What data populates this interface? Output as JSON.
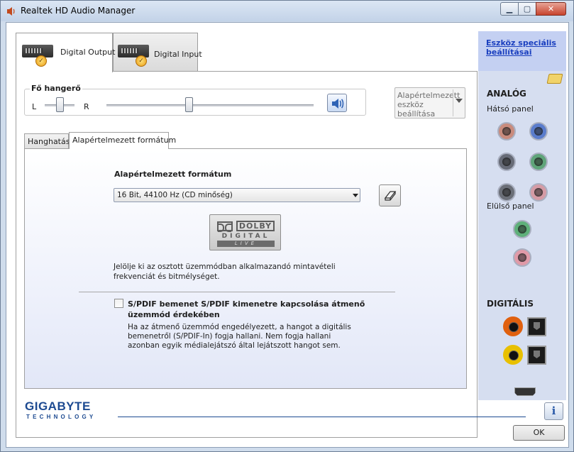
{
  "window": {
    "title": "Realtek HD Audio Manager",
    "controls": {
      "minimize": "▁",
      "maximize": "▢",
      "close": "✕"
    }
  },
  "device_tabs": [
    {
      "label": "Digital Output",
      "active": true,
      "icon": "digital-output-device-icon"
    },
    {
      "label": "Digital Input",
      "active": false,
      "icon": "digital-input-device-icon"
    }
  ],
  "volume": {
    "legend": "Fő hangerő",
    "left_label": "L",
    "right_label": "R",
    "balance_position": 0.5,
    "level": 0.4
  },
  "default_device_button": "Alapértelmezett eszköz beállítása",
  "sub_tabs": [
    {
      "label": "Hanghatás",
      "active": false
    },
    {
      "label": "Alapértelmezett formátum",
      "active": true
    }
  ],
  "format": {
    "title": "Alapértelmezett formátum",
    "selected": "16 Bit, 44100 Hz (CD minőség)",
    "dolby": {
      "word": "DOLBY",
      "digital": "DIGITAL",
      "live": "LIVE"
    },
    "description": "Jelölje ki az osztott üzemmódban alkalmazandó mintavételi frekvenciát és bitmélységet.",
    "spdif_label": "S/PDIF bemenet S/PDIF kimenetre kapcsolása átmenő üzemmód érdekében",
    "spdif_checked": false,
    "spdif_description": "Ha az átmenő üzemmód engedélyezett, a hangot a digitális bemenetről (S/PDIF-In) fogja hallani. Nem fogja hallani azonban egyik médialejátszó által lejátszott hangot sem."
  },
  "sidebar": {
    "link": "Eszköz speciális beállításai",
    "analog_title": "ANALÓG",
    "rear_panel": "Hátsó panel",
    "front_panel": "Elülső panel",
    "digital_title": "DIGITÁLIS",
    "rear_jacks": [
      "#c98b7d",
      "#5a7ccc",
      "#676b77",
      "#5fa479",
      "#6b6f78",
      "#d59ba5"
    ],
    "front_jacks": [
      "#5fb07a",
      "#e09aa8"
    ]
  },
  "footer": {
    "brand": "GIGABYTE",
    "brand_sub": "TECHNOLOGY",
    "info_icon": "i",
    "ok": "OK"
  },
  "colors": {
    "accent": "#1d4a91",
    "link": "#1a3fbf",
    "sidebar_bg": "#d6def0"
  }
}
